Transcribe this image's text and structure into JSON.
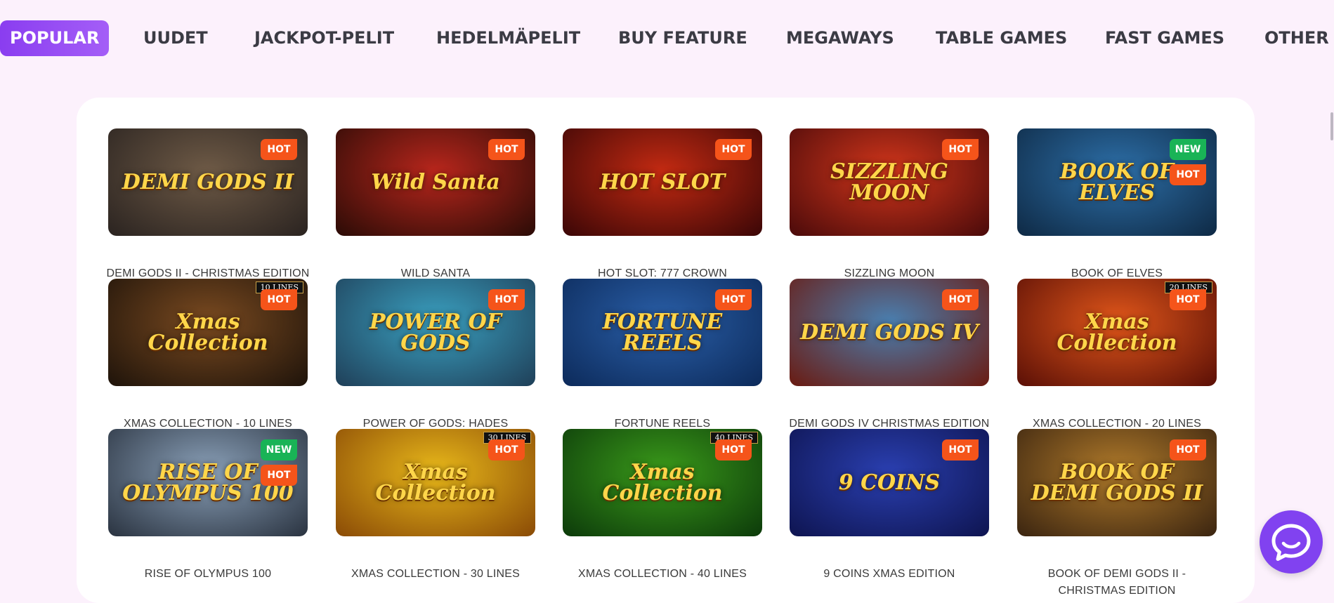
{
  "nav": {
    "tabs": [
      {
        "label": "POPULAR",
        "active": true
      },
      {
        "label": "UUDET"
      },
      {
        "label": "JACKPOT-PELIT"
      },
      {
        "label": "HEDELMÄPELIT"
      },
      {
        "label": "BUY FEATURE"
      },
      {
        "label": "MEGAWAYS"
      },
      {
        "label": "TABLE GAMES"
      },
      {
        "label": "FAST GAMES"
      },
      {
        "label": "OTHER"
      }
    ]
  },
  "badges": {
    "hot": "HOT",
    "new": "NEW"
  },
  "games": [
    {
      "title": "DEMI GODS II - CHRISTMAS EDITION",
      "art": "DEMI GODS II",
      "badges": [
        "hot"
      ],
      "tag": "",
      "bg": "#6e5a46",
      "bg2": "#2a2320"
    },
    {
      "title": "WILD SANTA",
      "art": "Wild Santa",
      "badges": [
        "hot"
      ],
      "tag": "",
      "bg": "#b8261c",
      "bg2": "#2a0b06"
    },
    {
      "title": "HOT SLOT: 777 CROWN",
      "art": "HOT SLOT",
      "badges": [
        "hot"
      ],
      "tag": "",
      "bg": "#c32a12",
      "bg2": "#3a0606"
    },
    {
      "title": "SIZZLING MOON",
      "art": "SIZZLING MOON",
      "badges": [
        "hot"
      ],
      "tag": "",
      "bg": "#d2361b",
      "bg2": "#4a0a0a"
    },
    {
      "title": "BOOK OF ELVES",
      "art": "BOOK OF ELVES",
      "badges": [
        "new",
        "hot"
      ],
      "tag": "",
      "bg": "#2d6fa8",
      "bg2": "#0e2944"
    },
    {
      "title": "XMAS COLLECTION - 10 LINES",
      "art": "Xmas Collection",
      "badges": [
        "hot"
      ],
      "tag": "10 LINES",
      "bg": "#7a4a20",
      "bg2": "#1e130a"
    },
    {
      "title": "POWER OF GODS: HADES",
      "art": "POWER OF GODS",
      "badges": [
        "hot"
      ],
      "tag": "",
      "bg": "#3aa0c0",
      "bg2": "#1f3f58"
    },
    {
      "title": "FORTUNE REELS",
      "art": "FORTUNE REELS",
      "badges": [
        "hot"
      ],
      "tag": "",
      "bg": "#2a5fa8",
      "bg2": "#0c2a5a"
    },
    {
      "title": "DEMI GODS IV CHRISTMAS EDITION",
      "art": "DEMI GODS IV",
      "badges": [
        "hot"
      ],
      "tag": "",
      "bg": "#4a7fb0",
      "bg2": "#6a1a10"
    },
    {
      "title": "XMAS COLLECTION - 20 LINES",
      "art": "Xmas Collection",
      "badges": [
        "hot"
      ],
      "tag": "20 LINES",
      "bg": "#e0561a",
      "bg2": "#5a0f06"
    },
    {
      "title": "RISE OF OLYMPUS 100",
      "art": "RISE OF OLYMPUS 100",
      "badges": [
        "new",
        "hot"
      ],
      "tag": "",
      "bg": "#8aa0b8",
      "bg2": "#2a3340"
    },
    {
      "title": "XMAS COLLECTION - 30 LINES",
      "art": "Xmas Collection",
      "badges": [
        "hot"
      ],
      "tag": "30 LINES",
      "bg": "#e8b81a",
      "bg2": "#8a4a06"
    },
    {
      "title": "XMAS COLLECTION - 40 LINES",
      "art": "Xmas Collection",
      "badges": [
        "hot"
      ],
      "tag": "40 LINES",
      "bg": "#3a9a1a",
      "bg2": "#0c3a0a"
    },
    {
      "title": "9 COINS XMAS EDITION",
      "art": "9 COINS",
      "badges": [
        "hot"
      ],
      "tag": "",
      "bg": "#2a3fb0",
      "bg2": "#0e1450"
    },
    {
      "title": "BOOK OF DEMI GODS II - CHRISTMAS EDITION",
      "art": "BOOK OF DEMI GODS II",
      "badges": [
        "hot"
      ],
      "tag": "",
      "bg": "#b07a2a",
      "bg2": "#3a2410"
    }
  ],
  "chat": {
    "icon": "chat-bubble-icon",
    "color": "#8142f0"
  }
}
